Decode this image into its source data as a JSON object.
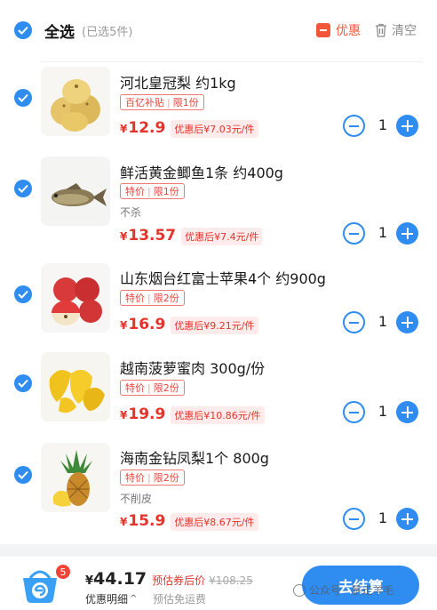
{
  "header": {
    "select_all_label": "全选",
    "selected_count": "(已选5件)",
    "coupon_label": "优惠",
    "clear_label": "清空"
  },
  "items": [
    {
      "title": "河北皇冠梨 约1kg",
      "tag_a": "百亿补贴",
      "tag_b": "限1份",
      "note": "",
      "price_symbol": "¥",
      "price": "12.9",
      "after_discount": "优惠后¥7.03元/件",
      "quantity": "1",
      "icon": "pear-image"
    },
    {
      "title": "鲜活黄金鲫鱼1条 约400g",
      "tag_a": "特价",
      "tag_b": "限1份",
      "note": "不杀",
      "price_symbol": "¥",
      "price": "13.57",
      "after_discount": "优惠后¥7.4元/件",
      "quantity": "1",
      "icon": "fish-image"
    },
    {
      "title": "山东烟台红富士苹果4个 约900g",
      "tag_a": "特价",
      "tag_b": "限2份",
      "note": "",
      "price_symbol": "¥",
      "price": "16.9",
      "after_discount": "优惠后¥9.21元/件",
      "quantity": "1",
      "icon": "apple-image"
    },
    {
      "title": "越南菠萝蜜肉 300g/份",
      "tag_a": "特价",
      "tag_b": "限2份",
      "note": "",
      "price_symbol": "¥",
      "price": "19.9",
      "after_discount": "优惠后¥10.86元/件",
      "quantity": "1",
      "icon": "jackfruit-image"
    },
    {
      "title": "海南金钻凤梨1个 800g",
      "tag_a": "特价",
      "tag_b": "限2份",
      "note": "不削皮",
      "price_symbol": "¥",
      "price": "15.9",
      "after_discount": "优惠后¥8.67元/件",
      "quantity": "1",
      "icon": "pineapple-image"
    }
  ],
  "footer": {
    "cart_count": "5",
    "total_symbol": "¥",
    "total": "44.17",
    "estimate_label": "预估券后价",
    "original_price": "¥108.25",
    "detail_label": "优惠明细",
    "detail_chevron": "^",
    "shipping_label": "预估免运费",
    "checkout_label": "去结算"
  },
  "watermark": {
    "text": "公众号 · 暴走羊毛"
  },
  "colors": {
    "accent_blue": "#2f8cf0",
    "price_red": "#e3342b",
    "badge_red": "#f04438"
  }
}
